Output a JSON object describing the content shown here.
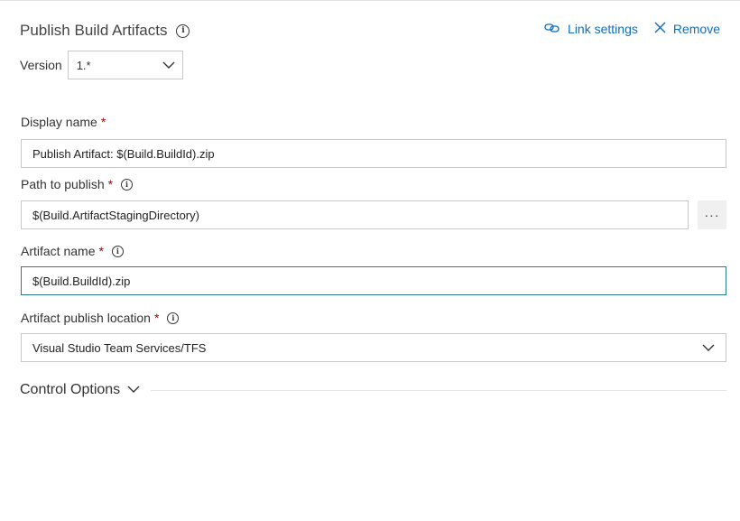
{
  "header": {
    "title": "Publish Build Artifacts",
    "link_settings": "Link settings",
    "remove": "Remove"
  },
  "version": {
    "label": "Version",
    "value": "1.*"
  },
  "fields": {
    "display_name": {
      "label": "Display name",
      "required": "*",
      "value": "Publish Artifact: $(Build.BuildId).zip"
    },
    "path_to_publish": {
      "label": "Path to publish",
      "required": "*",
      "value": "$(Build.ArtifactStagingDirectory)",
      "browse": "···"
    },
    "artifact_name": {
      "label": "Artifact name",
      "required": "*",
      "value": "$(Build.BuildId).zip"
    },
    "artifact_publish_location": {
      "label": "Artifact publish location",
      "required": "*",
      "value": "Visual Studio Team Services/TFS"
    }
  },
  "control_options": {
    "label": "Control Options"
  },
  "icons": {
    "info": "info-icon",
    "link": "link-icon",
    "close": "close-icon",
    "chevron": "chevron-down-icon"
  },
  "colors": {
    "accent": "#106ebe",
    "required": "#a80000",
    "focus_border": "#2a7c8c"
  }
}
